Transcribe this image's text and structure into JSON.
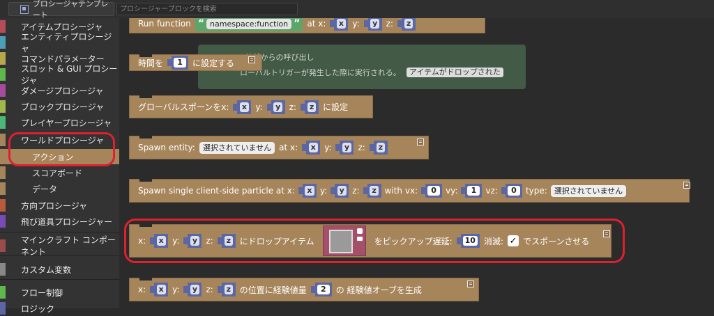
{
  "top": {
    "templates_tab": "プロシージャテンプレート",
    "search_placeholder": "プロシージャーブロックを検索"
  },
  "sidebar": [
    {
      "label": "アイテムプロシージャ",
      "color": "#b84b5a"
    },
    {
      "label": "エンティティプロシージャ",
      "color": "#4b9fb8"
    },
    {
      "label": "コマンドパラメーター",
      "color": "#b8a84b"
    },
    {
      "label": "スロット & GUI プロシージャ",
      "color": "#5fb84b"
    },
    {
      "label": "ダメージプロシージャ",
      "color": "#a84b9f"
    },
    {
      "label": "ブロックプロシージャ",
      "color": "#9fb84b"
    },
    {
      "label": "プレイヤープロシージャ",
      "color": "#4bb87a"
    },
    {
      "label": "ワールドプロシージャ",
      "color": "#a7855b"
    },
    {
      "label": "アクション",
      "color": "#a7855b"
    },
    {
      "label": "スコアボード",
      "color": "#a7855b"
    },
    {
      "label": "データ",
      "color": "#a7855b"
    },
    {
      "label": "方向プロシージャ",
      "color": "#b85b3c"
    },
    {
      "label": "飛び道具プロシージャー",
      "color": "#7a4bb8"
    },
    {
      "label": "マインクラフト コンポーネント",
      "color": "#9b4b4b"
    },
    {
      "label": "カスタム変数",
      "color": "#888888"
    },
    {
      "label": "フロー制御",
      "color": "#5fb84b"
    },
    {
      "label": "ロジック",
      "color": "#5b67a5"
    }
  ],
  "blocks": {
    "run_function": {
      "label": "Run function",
      "arg": "namespace:function",
      "at": "at x:",
      "x": "x",
      "y_label": "y:",
      "y": "y",
      "z_label": "z:",
      "z": "z"
    },
    "set_time": {
      "prefix": "時間を",
      "value": "1",
      "suffix": "に設定する"
    },
    "ghost_comment": {
      "line1": "- 外部からの呼び出し",
      "line2": "ローバルトリガーが発生した際に実行される。",
      "tag": "アイテムがドロップされた"
    },
    "global_spawn": {
      "prefix": "グローバルスポーンをx:",
      "x": "x",
      "y_label": "y:",
      "y": "y",
      "z_label": "z:",
      "z": "z",
      "suffix": "に設定"
    },
    "spawn_entity": {
      "prefix": "Spawn entity:",
      "dropdown": "選択されていません",
      "at": "at x:",
      "x": "x",
      "y_label": "y:",
      "y": "y",
      "z_label": "z:",
      "z": "z"
    },
    "spawn_particle": {
      "prefix": "Spawn single client-side particle at x:",
      "x": "x",
      "y_label": "y:",
      "y": "y",
      "z_label": "z:",
      "z": "z",
      "vx_label": "with vx:",
      "vx": "0",
      "vy_label": "vy:",
      "vy": "1",
      "vz_label": "vz:",
      "vz": "0",
      "type_label": "type:",
      "type": "選択されていません"
    },
    "drop_item": {
      "x_label": "x:",
      "x": "x",
      "y_label": "y:",
      "y": "y",
      "z_label": "z:",
      "z": "z",
      "mid": "にドロップアイテム",
      "pickup": "をピックアップ遅延:",
      "delay": "10",
      "despawn": "消滅:",
      "check": "✓",
      "end": "でスポーンさせる"
    },
    "xp_orb": {
      "x_label": "x:",
      "x": "x",
      "y_label": "y:",
      "y": "y",
      "z_label": "z:",
      "z": "z",
      "mid": "の位置に経験値量",
      "amount": "2",
      "end": "の 経験値オーブを生成"
    }
  },
  "highlight_color": "#e0202e"
}
